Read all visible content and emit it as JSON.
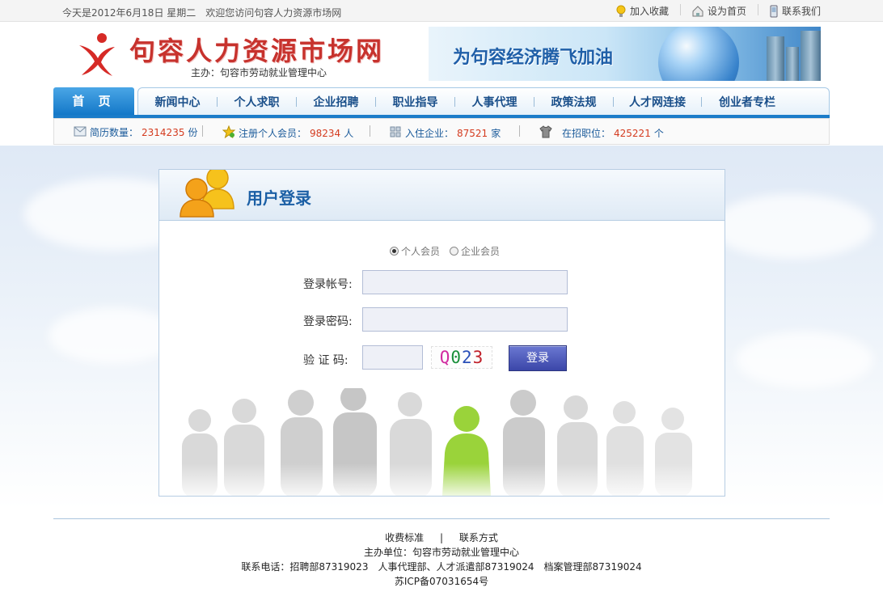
{
  "topbar": {
    "greeting": "今天是2012年6月18日 星期二　欢迎您访问句容人力资源市场网",
    "links": [
      {
        "label": "加入收藏",
        "icon": "lightbulb-icon"
      },
      {
        "label": "设为首页",
        "icon": "home-icon"
      },
      {
        "label": "联系我们",
        "icon": "phone-icon"
      }
    ]
  },
  "header": {
    "site_name": "句容人力资源市场网",
    "host": "主办：句容市劳动就业管理中心",
    "banner_slogan": "为句容经济腾飞加油"
  },
  "nav": {
    "home": "首 页",
    "items": [
      "新闻中心",
      "个人求职",
      "企业招聘",
      "职业指导",
      "人事代理",
      "政策法规",
      "人才网连接",
      "创业者专栏"
    ]
  },
  "stats": [
    {
      "label": "简历数量：",
      "value": "2314235",
      "unit": "份",
      "icon": "resume-icon"
    },
    {
      "label": "注册个人会员：",
      "value": "98234",
      "unit": "人",
      "icon": "star-member-icon"
    },
    {
      "label": "入住企业：",
      "value": "87521",
      "unit": "家",
      "icon": "building-icon"
    },
    {
      "label": "在招职位：",
      "value": "425221",
      "unit": "个",
      "icon": "shirt-icon"
    }
  ],
  "login": {
    "title": "用户登录",
    "member_types": [
      {
        "label": "个人会员",
        "selected": true
      },
      {
        "label": "企业会员",
        "selected": false
      }
    ],
    "account_label": "登录帐号:",
    "password_label": "登录密码:",
    "captcha_label": "验 证 码:",
    "account_value": "",
    "password_value": "",
    "captcha_value": "",
    "captcha_chars": [
      "Q",
      "0",
      "2",
      "3"
    ],
    "captcha_colors": [
      "#d12ba0",
      "#1a8f3a",
      "#2a4fb8",
      "#c0202a"
    ],
    "submit_label": "登录"
  },
  "footer": {
    "link1": "收费标准",
    "link2": "联系方式",
    "host": "主办单位：句容市劳动就业管理中心",
    "phones": "联系电话：招聘部87319023　人事代理部、人才派遣部87319024　档案管理部87319024",
    "icp": "苏ICP备07031654号"
  },
  "colors": {
    "brand_red": "#c7322d",
    "nav_blue": "#1b7cc9",
    "stat_number": "#d43b1f",
    "button": "#4a56bc"
  }
}
